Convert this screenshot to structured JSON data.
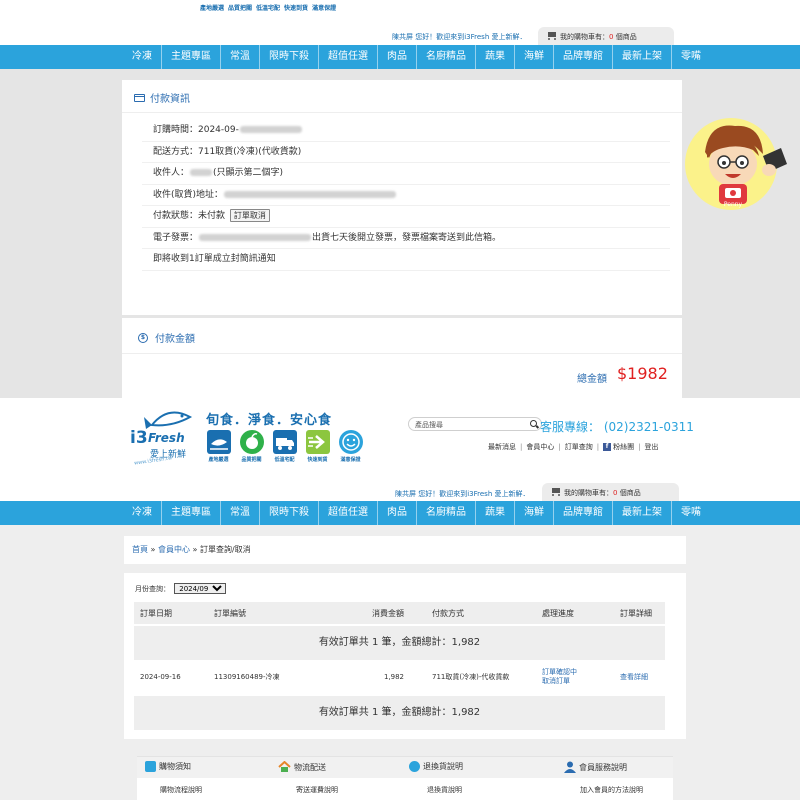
{
  "brand": {
    "logo_i3": "i3",
    "logo_fresh": "Fresh",
    "logo_cn": "愛上新鮮",
    "logo_url": "www.i3fresh.tw",
    "slogan": "旬食．淨食．安心食",
    "accent_color": "#2ba3dc",
    "link_color": "#2b6cb0",
    "price_color": "#e02020"
  },
  "feature_icons": [
    {
      "icon": "fish-icon",
      "label": "產地嚴選",
      "color": "#1a6fb0"
    },
    {
      "icon": "apple-icon",
      "label": "品質把關",
      "color": "#2fb14a"
    },
    {
      "icon": "cold-chain-icon",
      "label": "低溫宅配",
      "color": "#1a6fb0"
    },
    {
      "icon": "fast-delivery-icon",
      "label": "快速到貨",
      "color": "#8cc63f"
    },
    {
      "icon": "smile-icon",
      "label": "滿意保證",
      "color": "#1a6fb0"
    }
  ],
  "header": {
    "search_placeholder": "產品搜尋",
    "hotline": "客服專線： (02)2321-0311",
    "links": [
      "最新消息",
      "會員中心",
      "訂單查詢",
      "粉絲團",
      "登出"
    ],
    "fb_glyph": "f",
    "welcome": "陳共屏 您好！歡迎來到i3Fresh 愛上新鮮．",
    "cart_prefix": "我的購物車有：",
    "cart_count": "0",
    "cart_suffix": " 個商品"
  },
  "nav": [
    "冷凍",
    "主題專區",
    "常溫",
    "限時下殺",
    "超值任選",
    "肉品",
    "名廚精品",
    "蔬果",
    "海鮮",
    "品牌專館",
    "最新上架",
    "零嘴"
  ],
  "payment_info": {
    "title": "付款資訊",
    "order_time_label": "訂購時間：2024-09-",
    "shipping": "配送方式：711取貨(冷凍)(代收貨款)",
    "recipient_label": "收件人：",
    "recipient_note": "(只顯示第二個字)",
    "address_label": "收件(取貨)地址：",
    "status_label": "付款狀態：未付款",
    "cancel_button": "訂單取消",
    "einvoice_label": "電子發票：",
    "einvoice_note": "出貨七天後開立發票，發票檔案寄送到此信箱。",
    "sms_note": "即將收到1訂單成立封簡訊通知"
  },
  "amount": {
    "title": "付款金額",
    "coin_glyph": "$",
    "total_label": "總金額",
    "total_value": "$1982"
  },
  "breadcrumb": {
    "home": "首頁",
    "member": "會員中心",
    "current": "訂單查詢/取消",
    "sep": " » "
  },
  "orders": {
    "month_label": "月份查詢：",
    "month_value": "2024/09",
    "headers": [
      "訂單日期",
      "訂單編號",
      "消費金額",
      "付款方式",
      "處理進度",
      "訂單詳細"
    ],
    "summary": "有效訂單共 1 筆，金額總計：1,982",
    "rows": [
      {
        "date": "2024-09-16",
        "order_no": "11309160489-冷凍",
        "amount": "1,982",
        "payment": "711取貨(冷凍)-代收貨款",
        "status_1": "訂單確認中",
        "status_2": "取消訂單",
        "detail": "查看詳細"
      }
    ]
  },
  "footer": {
    "columns": [
      {
        "icon": "cart-guide-icon",
        "title": "購物須知",
        "sub": "購物流程說明"
      },
      {
        "icon": "house-icon",
        "title": "物流配送",
        "sub": "寄送運費說明"
      },
      {
        "icon": "refresh-icon",
        "title": "退換貨說明",
        "sub": "退換貨說明"
      },
      {
        "icon": "user-icon",
        "title": "會員服務說明",
        "sub": "加入會員的方法說明"
      }
    ]
  },
  "mascot": {
    "badge_text": "Penny"
  }
}
